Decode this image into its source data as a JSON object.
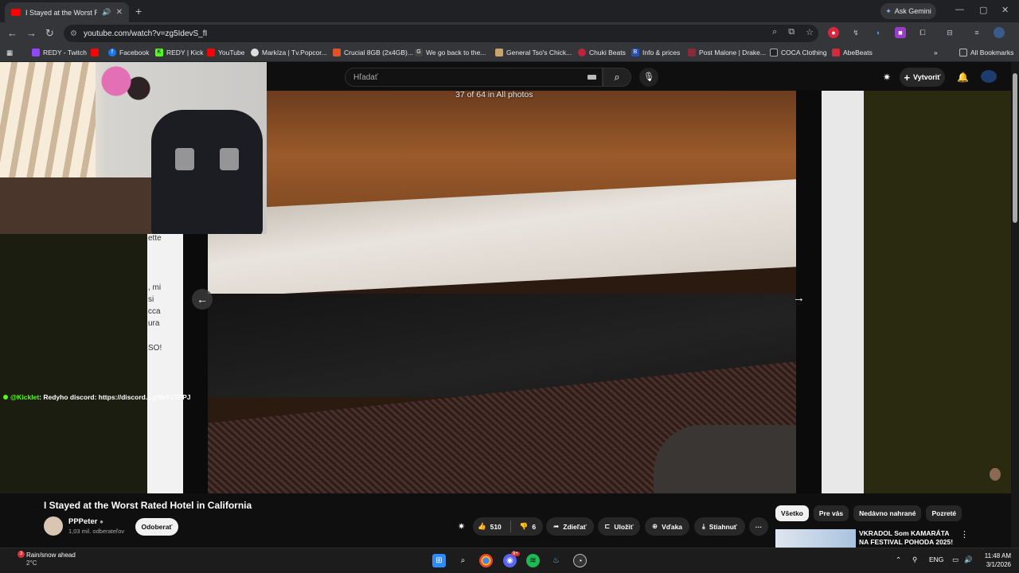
{
  "browser": {
    "tab_title": "I Stayed at the Worst Rated Hotel in California",
    "ask_gemini": "Ask Gemini",
    "url": "youtube.com/watch?v=zg5IdevS_fI",
    "bookmarks": [
      "REDY - Twitch",
      "Facebook",
      "REDY | Kick",
      "YouTube",
      "Markíza | Tv.Popcor...",
      "Crucial 8GB (2x4GB)...",
      "We go back to the...",
      "General Tso's Chick...",
      "Chuki Beats",
      "Info & prices",
      "Post Malone | Drake...",
      "COCA Clothing",
      "AbeBeats"
    ],
    "all_bookmarks": "All Bookmarks"
  },
  "chat": {
    "fragments": [
      "ette",
      "",
      ", mi",
      "si",
      "cca",
      "ura",
      "SO!"
    ],
    "message_user": "@Kicklet",
    "message_text": ": Redyho discord: https://discord.gg/6hYsTPPJ"
  },
  "youtube": {
    "search_placeholder": "Hľadať",
    "create_label": "Vytvoriť",
    "photo_counter": "37 of 64 in All photos",
    "video_title": "I Stayed at the Worst Rated Hotel in California",
    "channel_name": "PPPeter",
    "channel_subs": "1,03 mil. odberateľov",
    "subscribe_label": "Odoberať",
    "likes": "510",
    "dislikes": "6",
    "share_label": "Zdieľať",
    "save_label": "Uložiť",
    "thanks_label": "Vďaka",
    "download_label": "Stiahnuť",
    "more_label": "···",
    "chips": [
      "Všetko",
      "Pre vás",
      "Nedávno nahrané",
      "Pozreté"
    ],
    "rec_title": "VKRADOL Som KAMARÁTA NA FESTIVAL POHODA 2025!"
  },
  "taskbar": {
    "weather_title": "Rain/snow ahead",
    "weather_temp": "2°C",
    "weather_badge": "3",
    "language": "ENG",
    "time": "11:48 AM",
    "date": "3/1/2026",
    "discord_badge": "9+"
  }
}
